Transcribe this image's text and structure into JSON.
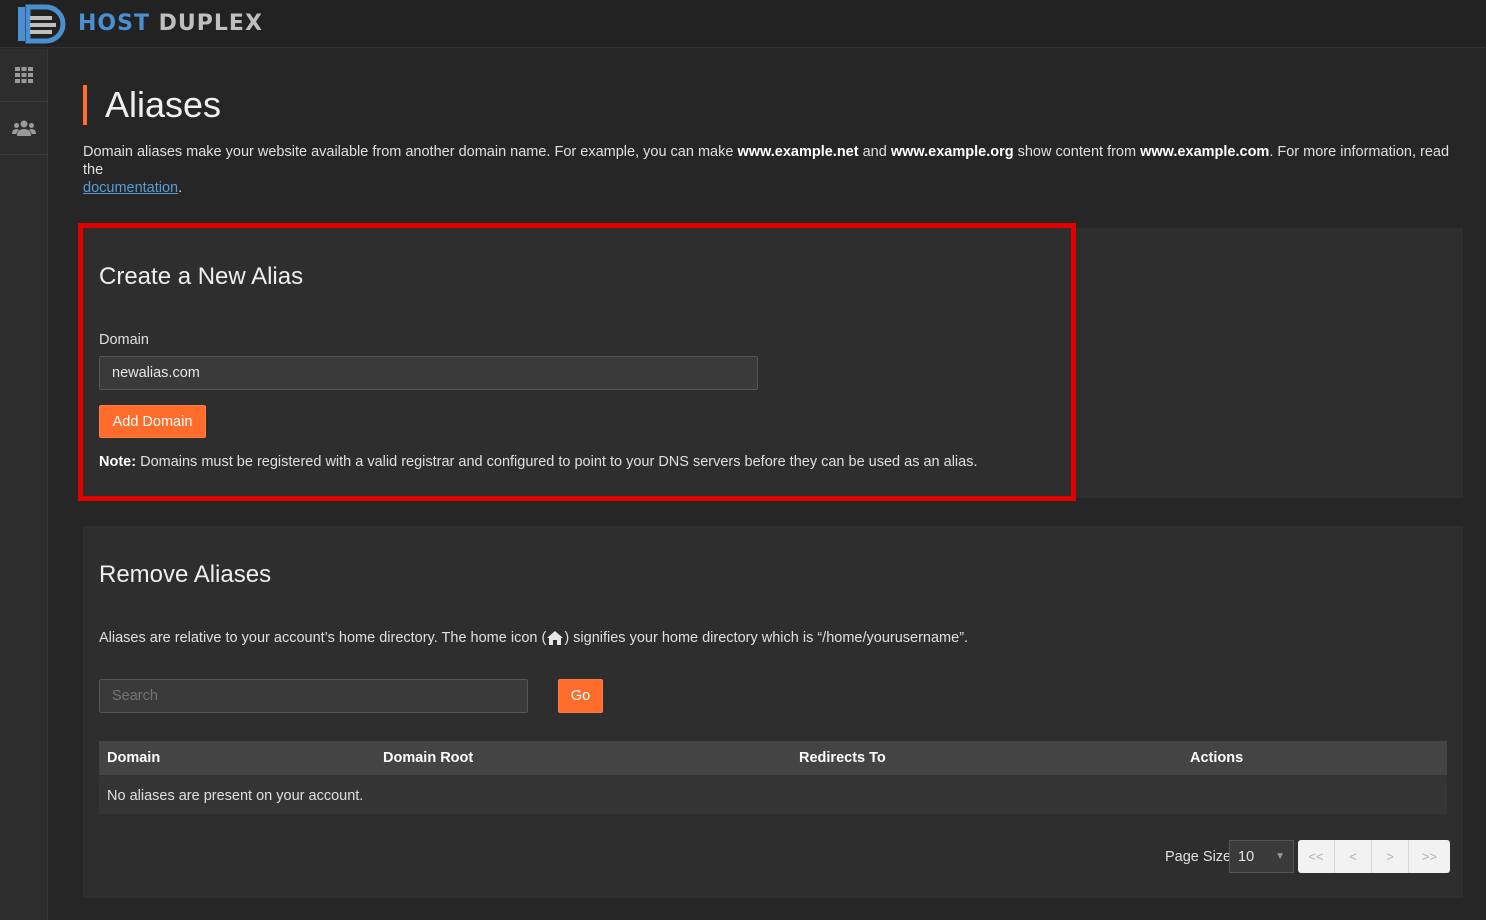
{
  "brand": {
    "word1": "HOST",
    "word2": "DUPLEX",
    "logo_icon": "host-duplex-logo-icon"
  },
  "sidebar": {
    "items": [
      {
        "icon": "grid-icon"
      },
      {
        "icon": "users-icon"
      }
    ]
  },
  "page": {
    "title": "Aliases",
    "intro_1": "Domain aliases make your website available from another domain name. For example, you can make ",
    "intro_b1": "www.example.net",
    "intro_2": " and ",
    "intro_b2": "www.example.org",
    "intro_3": " show content from ",
    "intro_b3": "www.example.com",
    "intro_4": ". For more information, read the ",
    "intro_link": "documentation",
    "intro_5": "."
  },
  "create": {
    "heading": "Create a New Alias",
    "domain_label": "Domain",
    "domain_value": "newalias.com",
    "add_button": "Add Domain",
    "note_label": "Note:",
    "note_text": " Domains must be registered with a valid registrar and configured to point to your DNS servers before they can be used as an alias."
  },
  "remove": {
    "heading": "Remove Aliases",
    "desc_1": "Aliases are relative to your account’s home directory. The home icon (",
    "desc_2": ") signifies your home directory which is “/home/yourusername”.",
    "search_placeholder": "Search",
    "go_button": "Go",
    "table": {
      "headers": [
        "Domain",
        "Domain Root",
        "Redirects To",
        "Actions"
      ],
      "empty_message": "No aliases are present on your account."
    },
    "page_size_label": "Page Size",
    "page_size_value": "10",
    "pager": [
      "<<",
      "<",
      ">",
      ">>"
    ]
  },
  "colors": {
    "accent": "#ff6c2c",
    "highlight": "#e00000",
    "link": "#5b9bd5",
    "brand_blue": "#4a8fd1"
  }
}
